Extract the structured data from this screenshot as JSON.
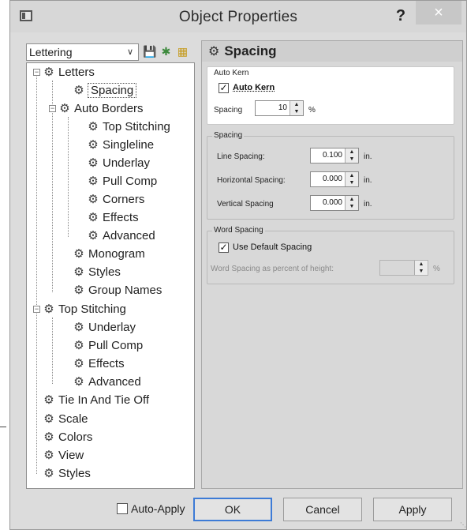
{
  "window": {
    "title": "Object Properties",
    "help_label": "?",
    "close_label": "×"
  },
  "left_pane": {
    "combo_value": "Lettering",
    "toolbar_icons": [
      "save-icon",
      "properties-icon-a",
      "properties-icon-b"
    ],
    "tree": [
      {
        "label": "Letters",
        "level": 0,
        "expander": "-"
      },
      {
        "label": "Spacing",
        "level": 1,
        "selected": true
      },
      {
        "label": "Auto Borders",
        "level": 1,
        "expander": "-"
      },
      {
        "label": "Top Stitching",
        "level": 2
      },
      {
        "label": "Singleline",
        "level": 2
      },
      {
        "label": "Underlay",
        "level": 2
      },
      {
        "label": "Pull Comp",
        "level": 2
      },
      {
        "label": "Corners",
        "level": 2
      },
      {
        "label": "Effects",
        "level": 2
      },
      {
        "label": "Advanced",
        "level": 2
      },
      {
        "label": "Monogram",
        "level": 1
      },
      {
        "label": "Styles",
        "level": 1
      },
      {
        "label": "Group Names",
        "level": 1
      },
      {
        "label": "Top Stitching",
        "level": 0,
        "expander": "-"
      },
      {
        "label": "Underlay",
        "level": 1
      },
      {
        "label": "Pull Comp",
        "level": 1
      },
      {
        "label": "Effects",
        "level": 1
      },
      {
        "label": "Advanced",
        "level": 1
      },
      {
        "label": "Tie In And Tie Off",
        "level": 0
      },
      {
        "label": "Scale",
        "level": 0
      },
      {
        "label": "Colors",
        "level": 0
      },
      {
        "label": "View",
        "level": 0
      },
      {
        "label": "Styles",
        "level": 0
      }
    ]
  },
  "right_pane": {
    "header": "Spacing",
    "auto_kern": {
      "title": "Auto Kern",
      "checkbox_label": "Auto Kern",
      "checked": true,
      "spacing_label": "Spacing",
      "spacing_value": "10",
      "spacing_unit": "%"
    },
    "spacing": {
      "title": "Spacing",
      "rows": [
        {
          "label": "Line Spacing:",
          "value": "0.100",
          "unit": "in."
        },
        {
          "label": "Horizontal Spacing:",
          "value": "0.000",
          "unit": "in."
        },
        {
          "label": "Vertical Spacing",
          "value": "0.000",
          "unit": "in."
        }
      ]
    },
    "word_spacing": {
      "title": "Word Spacing",
      "checkbox_label": "Use Default Spacing",
      "checked": true,
      "percent_label": "Word Spacing as percent of height:",
      "percent_value": "",
      "percent_unit": "%"
    }
  },
  "bottom": {
    "auto_apply_label": "Auto-Apply",
    "ok_label": "OK",
    "cancel_label": "Cancel",
    "apply_label": "Apply"
  }
}
